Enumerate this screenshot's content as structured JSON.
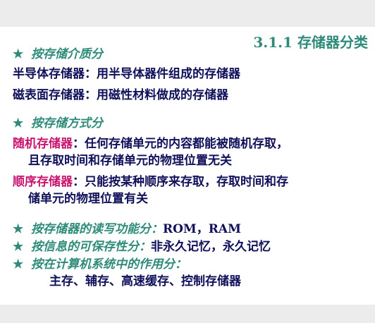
{
  "title": "3.1.1  存储器分类",
  "star_glyph": "★",
  "sections": {
    "by_medium": {
      "heading": "按存储介质分",
      "items": [
        {
          "term": "半导体存储器",
          "desc": "：用半导体器件组成的存储器"
        },
        {
          "term": "磁表面存储器",
          "desc": "：用磁性材料做成的存储器"
        }
      ]
    },
    "by_access": {
      "heading": "按存储方式分",
      "random": {
        "term": "随机存储器",
        "desc_line1": "：任何存储单元的内容都能被随机存取，",
        "desc_line2": "且存取时间和存储单元的物理位置无关"
      },
      "sequential": {
        "term": "顺序存储器",
        "desc_line1": "：只能按某种顺序来存取，存取时间和存",
        "desc_line2": "储单元的物理位置有关"
      }
    },
    "by_rw": {
      "heading": "按存储器的读写功能分：",
      "value": "ROM，RAM"
    },
    "by_retention": {
      "heading": "按信息的可保存性分：",
      "value": "非永久记忆，永久记忆"
    },
    "by_role": {
      "heading": "按在计算机系统中的作用分：",
      "value": "主存、辅存、高速缓存、控制存储器"
    }
  },
  "colors": {
    "heading": "#2e8b7a",
    "term_highlight": "#c8146e",
    "body_text": "#10105a",
    "slide_bg": "#ffffff",
    "page_bg": "#ececec"
  }
}
